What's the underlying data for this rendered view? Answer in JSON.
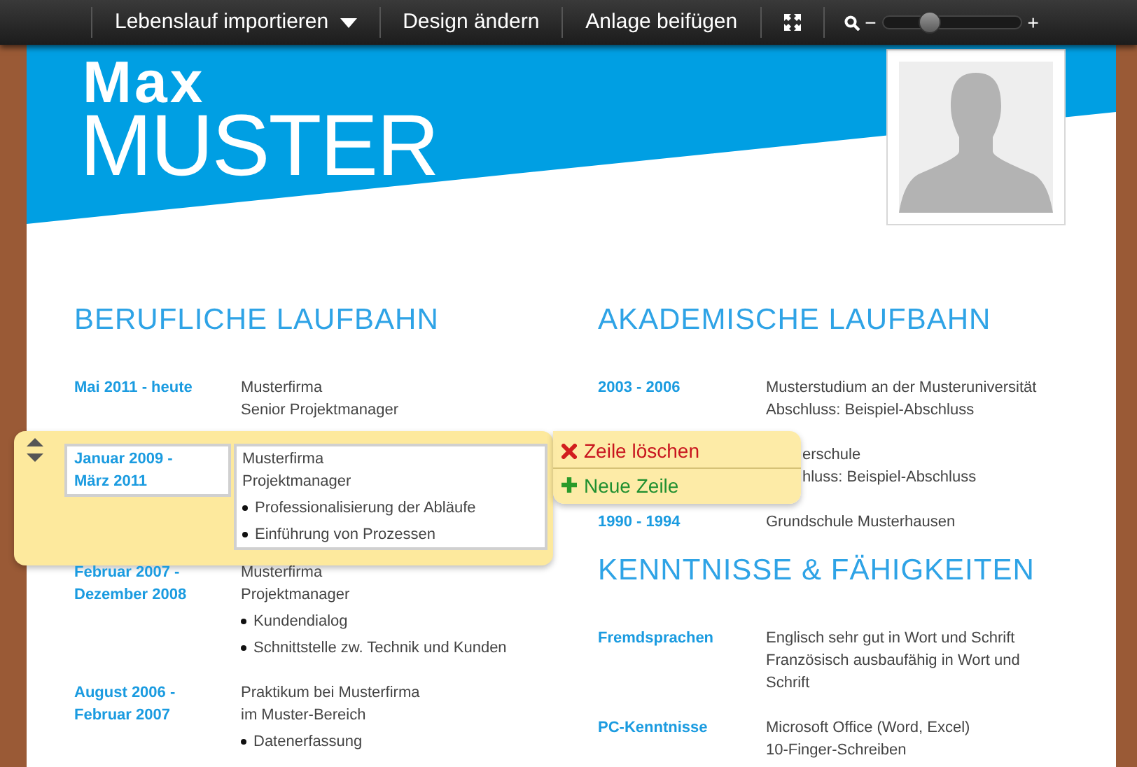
{
  "toolbar": {
    "items": [
      {
        "kind": "menu",
        "label": "Lebenslauf importieren"
      },
      {
        "kind": "button",
        "label": "Design ändern"
      },
      {
        "kind": "button",
        "label": "Anlage beifügen"
      },
      {
        "kind": "fullscreen"
      },
      {
        "kind": "zoom",
        "zoom_out": "−",
        "zoom_in": "+",
        "level": 0.33
      }
    ]
  },
  "resume": {
    "first_name": "Max",
    "last_name": "MUSTER",
    "left": [
      {
        "title": "BERUFLICHE LAUFBAHN",
        "entries": [
          {
            "date": "Mai 2011 - heute",
            "lines": [
              "Musterfirma",
              "Senior Projektmanager"
            ],
            "selected": false
          },
          {
            "date": "Januar 2009 - März 2011",
            "lines": [
              "Musterfirma",
              "Projektmanager"
            ],
            "bullets": [
              "Professionalisierung der Abläufe",
              "Einführung von Prozessen"
            ],
            "selected": true
          },
          {
            "date": "Februar 2007 - Dezember 2008",
            "lines": [
              "Musterfirma",
              "Projektmanager"
            ],
            "bullets": [
              "Kundendialog",
              "Schnittstelle zw. Technik und Kunden"
            ],
            "selected": false
          },
          {
            "date": "August 2006 - Februar 2007",
            "lines": [
              "Praktikum bei Musterfirma",
              "im Muster-Bereich"
            ],
            "bullets": [
              "Datenerfassung"
            ],
            "selected": false
          }
        ]
      }
    ],
    "right": [
      {
        "title": "AKADEMISCHE LAUFBAHN",
        "entries": [
          {
            "date": "2003 - 2006",
            "lines": [
              "Musterstudium an der Musteruniversität",
              "Abschluss: Beispiel-Abschluss"
            ],
            "selected": false
          },
          {
            "lines": [
              "erschule",
              "hluss: Beispiel-Abschluss"
            ],
            "selected": false
          },
          {
            "date": "1990 - 1994",
            "lines": [
              "Grundschule Musterhausen"
            ],
            "selected": false
          }
        ]
      },
      {
        "title": "KENNTNISSE & FÄHIGKEITEN",
        "entries": [
          {
            "date": "Fremdsprachen",
            "lines": [
              "Englisch sehr gut in Wort und Schrift",
              "Französisch ausbaufähig in Wort und",
              "Schrift"
            ],
            "selected": false
          },
          {
            "date": "PC-Kenntnisse",
            "lines": [
              "Microsoft Office (Word, Excel)",
              "10-Finger-Schreiben"
            ],
            "selected": false
          }
        ]
      }
    ]
  },
  "row_menu": {
    "items": [
      {
        "kind": "delete",
        "label": "Zeile löschen"
      },
      {
        "kind": "add",
        "label": "Neue Zeile"
      }
    ]
  }
}
